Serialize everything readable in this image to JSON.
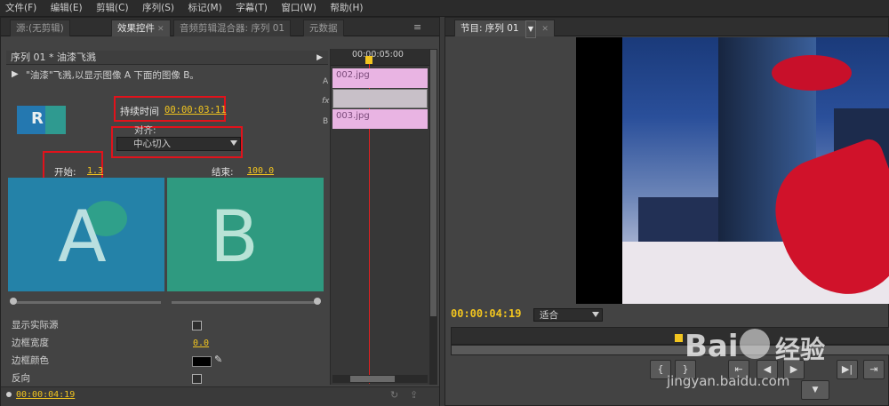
{
  "menu": {
    "items": [
      "文件(F)",
      "编辑(E)",
      "剪辑(C)",
      "序列(S)",
      "标记(M)",
      "字幕(T)",
      "窗口(W)",
      "帮助(H)"
    ]
  },
  "left_tabs": {
    "source": "源:(无剪辑)",
    "effect_controls": "效果控件",
    "audio_mixer": "音频剪辑混合器: 序列 01",
    "metadata": "元数据"
  },
  "effect": {
    "sequence_path": "序列 01 * 油漆飞溅",
    "description": "\"油漆\"飞溅,以显示图像 A 下面的图像 B。",
    "thumb_letter": "R",
    "duration_label": "持续时间",
    "duration_value": "00:00:03:11",
    "align_label": "对齐:",
    "align_value": "中心切入",
    "start_label": "开始:",
    "start_value": "1.3",
    "end_label": "结束:",
    "end_value": "100.0",
    "preview_a_letter": "A",
    "preview_b_letter": "B",
    "show_source_label": "显示实际源",
    "border_width_label": "边框宽度",
    "border_width_value": "0.0",
    "border_color_label": "边框颜色",
    "reverse_label": "反向",
    "footer_time": "00:00:04:19"
  },
  "mini_timeline": {
    "ruler_time": "00:00:05:00",
    "track_a_label": "A",
    "track_b_label": "B",
    "fx_label": "fx",
    "clip_a": "002.jpg",
    "clip_b": "003.jpg"
  },
  "program": {
    "tab_label": "节目: 序列 01",
    "timecode": "00:00:04:19",
    "fit_value": "适合"
  },
  "watermark": {
    "brand": "Bai",
    "brand2": "经验",
    "url": "jingyan.baidu.com"
  },
  "colors": {
    "accent_yellow": "#f2c51f",
    "highlight_red": "#e1121b",
    "clip_pink": "#e9b4e3",
    "preview_teal": "#2f9a90"
  }
}
